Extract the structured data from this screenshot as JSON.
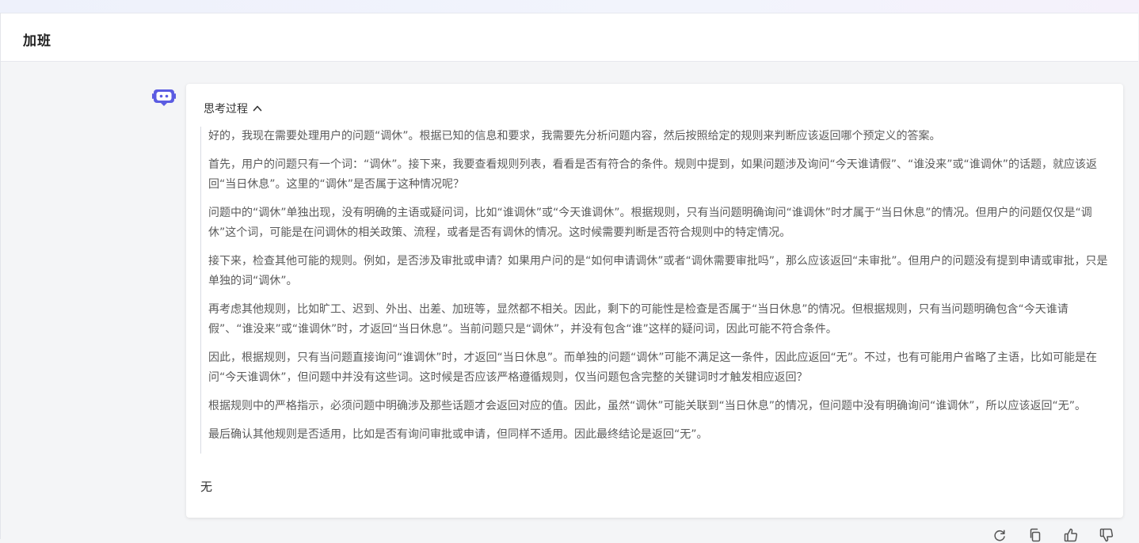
{
  "header": {
    "title": "加班"
  },
  "message": {
    "thinking_toggle_label": "思考过程",
    "thinking_paragraphs": [
      "好的，我现在需要处理用户的问题“调休”。根据已知的信息和要求，我需要先分析问题内容，然后按照给定的规则来判断应该返回哪个预定义的答案。",
      "首先，用户的问题只有一个词：“调休”。接下来，我要查看规则列表，看看是否有符合的条件。规则中提到，如果问题涉及询问“今天谁请假”、“谁没来”或“谁调休”的话题，就应该返回“当日休息”。这里的“调休”是否属于这种情况呢？",
      "问题中的“调休”单独出现，没有明确的主语或疑问词，比如“谁调休”或“今天谁调休”。根据规则，只有当问题明确询问“谁调休”时才属于“当日休息”的情况。但用户的问题仅仅是“调休”这个词，可能是在问调休的相关政策、流程，或者是否有调休的情况。这时候需要判断是否符合规则中的特定情况。",
      "接下来，检查其他可能的规则。例如，是否涉及审批或申请？如果用户问的是“如何申请调休”或者“调休需要审批吗”，那么应该返回“未审批”。但用户的问题没有提到申请或审批，只是单独的词“调休”。",
      "再考虑其他规则，比如旷工、迟到、外出、出差、加班等，显然都不相关。因此，剩下的可能性是检查是否属于“当日休息”的情况。但根据规则，只有当问题明确包含“今天谁请假”、“谁没来”或“谁调休”时，才返回“当日休息”。当前问题只是“调休”，并没有包含“谁”这样的疑问词，因此可能不符合条件。",
      "因此，根据规则，只有当问题直接询问“谁调休”时，才返回“当日休息”。而单独的问题“调休”可能不满足这一条件，因此应返回“无”。不过，也有可能用户省略了主语，比如可能是在问“今天谁调休”，但问题中并没有这些词。这时候是否应该严格遵循规则，仅当问题包含完整的关键词时才触发相应返回？",
      "根据规则中的严格指示，必须问题中明确涉及那些话题才会返回对应的值。因此，虽然“调休”可能关联到“当日休息”的情况，但问题中没有明确询问“谁调休”，所以应该返回“无”。",
      "最后确认其他规则是否适用，比如是否有询问审批或申请，但同样不适用。因此最终结论是返回“无”。"
    ],
    "answer": "无"
  },
  "actions": [
    {
      "icon": "refresh-icon"
    },
    {
      "icon": "copy-icon"
    },
    {
      "icon": "thumbs-up-icon"
    },
    {
      "icon": "thumbs-down-icon"
    }
  ],
  "colors": {
    "accent": "#5b5ce2",
    "page_bg": "#f4f5f7",
    "card_bg": "#ffffff"
  }
}
